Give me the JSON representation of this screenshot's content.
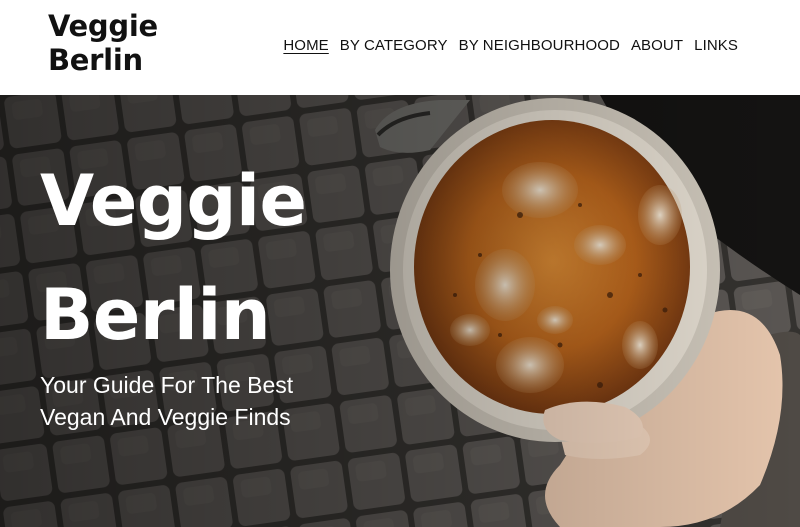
{
  "header": {
    "logo_line1": "Veggie",
    "logo_line2": "Berlin",
    "nav": [
      {
        "label": "HOME",
        "active": true
      },
      {
        "label": "BY CATEGORY",
        "active": false
      },
      {
        "label": "BY NEIGHBOURHOOD",
        "active": false
      },
      {
        "label": "ABOUT",
        "active": false
      },
      {
        "label": "LINKS",
        "active": false
      }
    ]
  },
  "hero": {
    "title_line1": "Veggie",
    "title_line2": "Berlin",
    "subtitle_line1": "Your Guide For The Best",
    "subtitle_line2": "Vegan And Veggie Finds"
  },
  "colors": {
    "header_bg": "#ffffff",
    "text_dark": "#111111",
    "hero_text": "#ffffff",
    "pavement": "#4a4745",
    "bowl_rim": "#d9d3c8",
    "food_orange": "#b8641c"
  }
}
